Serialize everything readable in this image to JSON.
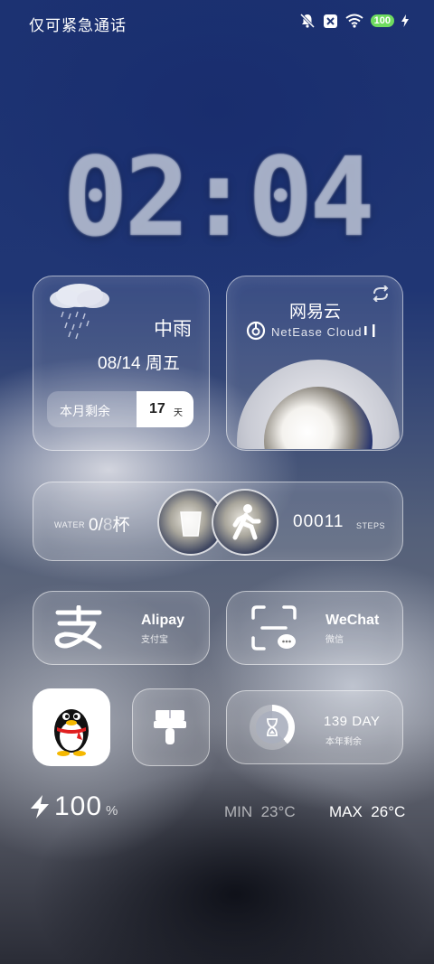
{
  "status_bar": {
    "carrier_text": "仅可紧急通话",
    "battery_level": "100"
  },
  "clock": {
    "time": "02:04"
  },
  "weather": {
    "condition": "中雨",
    "date": "08/14  周五",
    "remaining_label": "本月剩余",
    "remaining_value": "17",
    "remaining_unit": "天"
  },
  "music": {
    "app_name": "网易云",
    "app_sub": "NetEase Cloud"
  },
  "water": {
    "label": "WATER",
    "current": "0",
    "target": "8",
    "unit": "杯"
  },
  "steps": {
    "value": "00011",
    "label": "STEPS"
  },
  "apps": {
    "alipay_name": "Alipay",
    "alipay_sub": "支付宝",
    "wechat_name": "WeChat",
    "wechat_sub": "微信"
  },
  "year_progress": {
    "value": "139 DAY",
    "label": "本年剩余",
    "fraction_remaining": 0.38
  },
  "bottom": {
    "battery": "100",
    "battery_unit": "%",
    "min_label": "MIN  23°C",
    "max_label": "MAX  26°C"
  }
}
